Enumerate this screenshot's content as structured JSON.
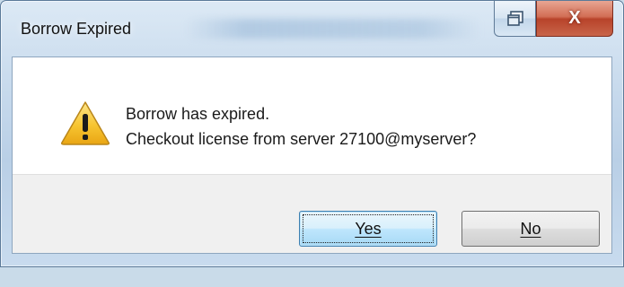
{
  "window": {
    "title": "Borrow Expired",
    "close_symbol": "X"
  },
  "message": {
    "icon": "warning-icon",
    "line1": "Borrow has expired.",
    "line2": "Checkout license from server 27100@myserver?"
  },
  "buttons": {
    "yes_label": "Yes",
    "no_label": "No"
  },
  "colors": {
    "frame": "#c6d9ec",
    "close_button": "#c8654a",
    "warning_fill": "#f7c531",
    "default_button_border": "#3c7fb1"
  }
}
